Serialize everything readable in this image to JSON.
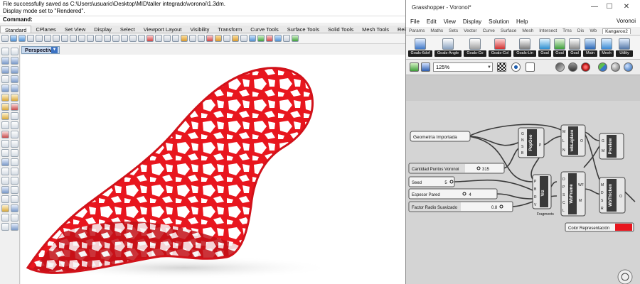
{
  "rhino": {
    "history_line_1": "File successfully saved as C:\\Users\\usuario\\Desktop\\MID\\taller integrado\\voronoi\\1.3dm.",
    "history_line_2": "Display mode set to \"Rendered\".",
    "command_prompt": "Command:",
    "tabs": [
      "Standard",
      "CPlanes",
      "Set View",
      "Display",
      "Select",
      "Viewport Layout",
      "Visibility",
      "Transform",
      "Curve Tools",
      "Surface Tools",
      "Solid Tools",
      "Mesh Tools",
      "Rei"
    ],
    "active_tab": "Standard",
    "viewport_name": "Perspective",
    "model_color": "#e8161e"
  },
  "grasshopper": {
    "window_title": "Grasshopper - Voronoi*",
    "window_controls": [
      "—",
      "☐",
      "✕"
    ],
    "menu": [
      "File",
      "Edit",
      "View",
      "Display",
      "Solution",
      "Help"
    ],
    "document_name": "Voronoi",
    "tabs": [
      "Params",
      "Maths",
      "Sets",
      "Vector",
      "Curve",
      "Surface",
      "Mesh",
      "Intersect",
      "Trns",
      "Dis",
      "Wb",
      "Kangaroo2"
    ],
    "active_tab": "Kangaroo2",
    "ribbon_components": [
      "Goals-6dof",
      "Goals-Angle",
      "Goals-Co",
      "Goals-Col",
      "Goals-Lin",
      "Goal",
      "Goal",
      "Goal",
      "Main",
      "Mesh",
      "Utility"
    ],
    "zoom": "125%",
    "nodes": {
      "geometria": "Geometría Importada",
      "puntos_label": "Cantidad Puntos Voronoi",
      "puntos_value": "315",
      "seed_label": "Seed",
      "seed_value": "5",
      "espesor_label": "Espesor Pared",
      "espesor_value": "4",
      "factor_label": "Factor Radio Suavizado",
      "factor_value": "0.8",
      "color_label": "Color Representación",
      "popgeo": "PopGeo",
      "popgeo_in": [
        "G",
        "N",
        "S",
        "B"
      ],
      "popgeo_out": "P",
      "vrz": "Vrz",
      "vrz_in": [
        "P",
        "B",
        "R",
        "V"
      ],
      "vrz_out": "Fragments",
      "wblaplace": "wbLaplace",
      "wblaplace_in": [
        "M",
        "L",
        "N"
      ],
      "wblaplace_out": "O",
      "wbframe": "WbFrame",
      "wbframe_in": [
        "D",
        "P",
        "S",
        "C",
        "L"
      ],
      "wbframe_out": [
        "WF",
        "M"
      ],
      "wbthicken": "WbThicken",
      "wbthicken_in": [
        "M",
        "D",
        "S",
        "R"
      ],
      "wbthicken_out": "O",
      "preview": "Preview",
      "preview_in": [
        "G",
        "M"
      ]
    },
    "accent_color": "#e8161e"
  }
}
